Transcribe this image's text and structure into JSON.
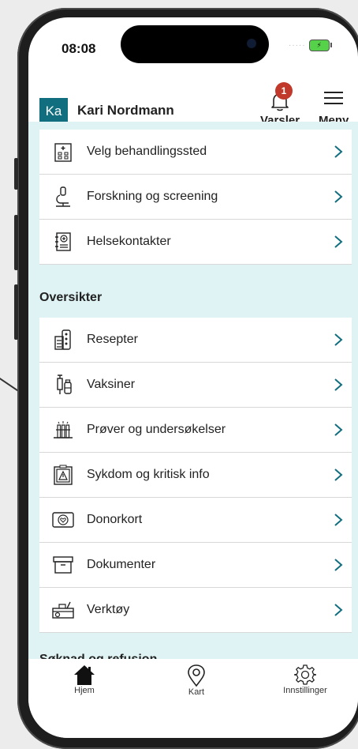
{
  "status_bar": {
    "time": "08:08",
    "battery_icon": "battery-charging-icon"
  },
  "header": {
    "avatar_initials": "Ka",
    "user_name": "Kari Nordmann",
    "notifications_label": "Varsler",
    "notifications_count": "1",
    "menu_label": "Meny"
  },
  "items_top": [
    {
      "label": "Velg behandlingssted",
      "icon": "hospital-building-icon"
    },
    {
      "label": "Forskning og screening",
      "icon": "microscope-icon"
    },
    {
      "label": "Helsekontakter",
      "icon": "contact-book-icon"
    }
  ],
  "section_overviews": "Oversikter",
  "items_overviews": [
    {
      "label": "Resepter",
      "icon": "prescription-icon"
    },
    {
      "label": "Vaksiner",
      "icon": "syringe-icon"
    },
    {
      "label": "Prøver og undersøkelser",
      "icon": "test-tubes-icon"
    },
    {
      "label": "Sykdom og kritisk info",
      "icon": "warning-clipboard-icon"
    },
    {
      "label": "Donorkort",
      "icon": "donor-card-icon"
    },
    {
      "label": "Dokumenter",
      "icon": "archive-box-icon"
    },
    {
      "label": "Verktøy",
      "icon": "toolbox-icon"
    }
  ],
  "section_applications": "Søknad og refusjon",
  "tabbar": {
    "home_label": "Hjem",
    "map_label": "Kart",
    "settings_label": "Innstillinger"
  },
  "colors": {
    "accent": "#116e7e",
    "background": "#dff3f4",
    "badge": "#c0392b"
  }
}
